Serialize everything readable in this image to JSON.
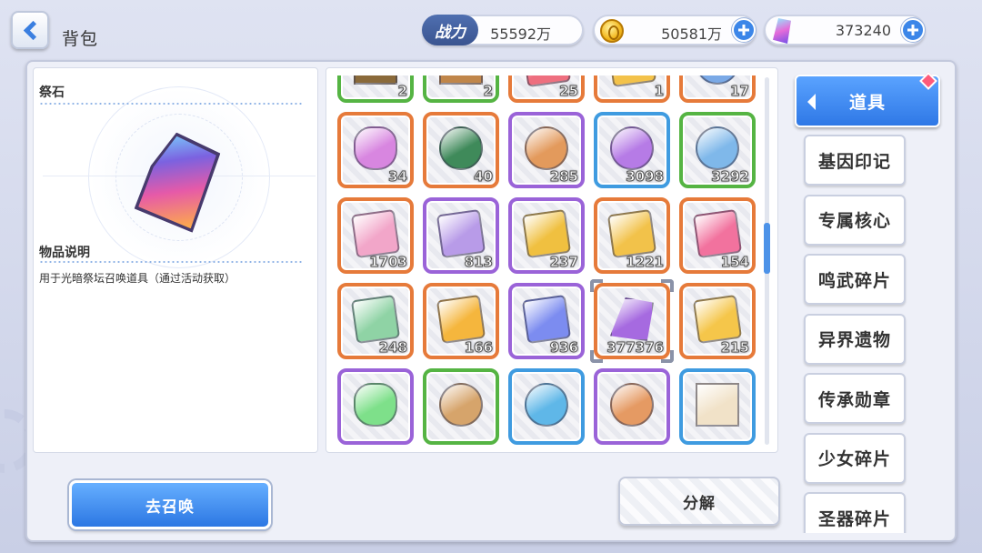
{
  "header": {
    "title": "背包",
    "power_label": "战力",
    "power_value": "55592万",
    "gold_value": "50581万",
    "gem_value": "373240"
  },
  "detail": {
    "item_name": "祭石",
    "desc_heading": "物品说明",
    "description": "用于光暗祭坛召唤道具（通过活动获取）"
  },
  "grid": {
    "items": [
      {
        "name": "chest",
        "count": "2",
        "rarity": "green",
        "color": "#8a6a3a",
        "shape": "box"
      },
      {
        "name": "gear-chest",
        "count": "2",
        "rarity": "green",
        "color": "#c0864a",
        "shape": "box"
      },
      {
        "name": "red-ticket",
        "count": "25",
        "rarity": "orange",
        "color": "#ee6f7f",
        "shape": "ticket"
      },
      {
        "name": "gold-ticket",
        "count": "1",
        "rarity": "orange",
        "color": "#f3c24a",
        "shape": "ticket"
      },
      {
        "name": "hourglass-orb",
        "count": "17",
        "rarity": "orange",
        "color": "#7aa9e6",
        "shape": "round"
      },
      {
        "name": "potion-bottle",
        "count": "34",
        "rarity": "orange",
        "color": "#d886e0",
        "shape": "bottle"
      },
      {
        "name": "cauldron",
        "count": "40",
        "rarity": "orange",
        "color": "#3f8a5a",
        "shape": "round"
      },
      {
        "name": "mech-core-orange",
        "count": "285",
        "rarity": "purple",
        "color": "#e39a5c",
        "shape": "round"
      },
      {
        "name": "mech-core-purple",
        "count": "3098",
        "rarity": "blue",
        "color": "#b67be6",
        "shape": "round"
      },
      {
        "name": "mech-core-blue",
        "count": "3292",
        "rarity": "green",
        "color": "#7fb8ea",
        "shape": "round"
      },
      {
        "name": "pink-ticket",
        "count": "1703",
        "rarity": "orange",
        "color": "#f2a6c9",
        "shape": "ticket"
      },
      {
        "name": "smile-ticket",
        "count": "813",
        "rarity": "purple",
        "color": "#b89be8",
        "shape": "ticket"
      },
      {
        "name": "gene-card-gold",
        "count": "237",
        "rarity": "purple",
        "color": "#f0c040",
        "shape": "ticket"
      },
      {
        "name": "gene-card-shard",
        "count": "1221",
        "rarity": "orange",
        "color": "#f2c24a",
        "shape": "ticket"
      },
      {
        "name": "gene-card-rainbow",
        "count": "154",
        "rarity": "orange",
        "color": "#f2729e",
        "shape": "ticket"
      },
      {
        "name": "rainbow-ticket",
        "count": "248",
        "rarity": "orange",
        "color": "#8fd3a5",
        "shape": "ticket"
      },
      {
        "name": "sword-card-gold",
        "count": "166",
        "rarity": "orange",
        "color": "#f5b63d",
        "shape": "ticket"
      },
      {
        "name": "sword-card-blue",
        "count": "936",
        "rarity": "purple",
        "color": "#7c8cf0",
        "shape": "ticket"
      },
      {
        "name": "sacrifice-stone",
        "count": "377376",
        "rarity": "orange",
        "color": "#a66ae0",
        "shape": "gem",
        "selected": true
      },
      {
        "name": "star-card-gold",
        "count": "215",
        "rarity": "orange",
        "color": "#f5c64a",
        "shape": "ticket"
      },
      {
        "name": "green-vial",
        "count": "",
        "rarity": "purple",
        "color": "#7ee08a",
        "shape": "bottle"
      },
      {
        "name": "cookies",
        "count": "",
        "rarity": "green",
        "color": "#d6a46b",
        "shape": "round"
      },
      {
        "name": "candy",
        "count": "",
        "rarity": "blue",
        "color": "#5fb7e8",
        "shape": "round"
      },
      {
        "name": "canned-food",
        "count": "",
        "rarity": "purple",
        "color": "#e59a63",
        "shape": "round"
      },
      {
        "name": "milk-carton",
        "count": "",
        "rarity": "blue",
        "color": "#f1e2c8",
        "shape": "box"
      }
    ]
  },
  "tabs": [
    {
      "label": "道具",
      "active": true
    },
    {
      "label": "基因印记"
    },
    {
      "label": "专属核心"
    },
    {
      "label": "鸣武碎片"
    },
    {
      "label": "异界遗物"
    },
    {
      "label": "传承勋章"
    },
    {
      "label": "少女碎片"
    },
    {
      "label": "圣器碎片"
    }
  ],
  "buttons": {
    "summon": "去召唤",
    "decompose": "分解"
  }
}
